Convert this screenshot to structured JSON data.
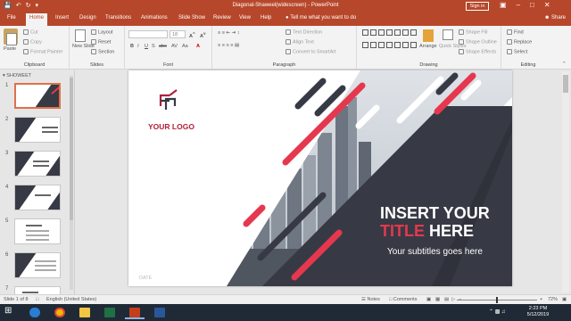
{
  "window": {
    "title": "Diagonal-Shaweel(widescreen) - PowerPoint",
    "sign_in": "Sign in",
    "share": "Share"
  },
  "tabs": [
    "File",
    "Home",
    "Insert",
    "Design",
    "Transitions",
    "Animations",
    "Slide Show",
    "Review",
    "View",
    "Help"
  ],
  "tell_me": "Tell me what you want to do",
  "ribbon": {
    "clipboard": {
      "name": "Clipboard",
      "paste": "Paste",
      "cut": "Cut",
      "copy": "Copy",
      "format_painter": "Format Painter"
    },
    "slides": {
      "name": "Slides",
      "new_slide": "New Slide",
      "layout": "Layout",
      "reset": "Reset",
      "section": "Section"
    },
    "font": {
      "name": "Font",
      "size": "18"
    },
    "paragraph": {
      "name": "Paragraph",
      "text_direction": "Text Direction",
      "align_text": "Align Text",
      "convert": "Convert to SmartArt"
    },
    "drawing": {
      "name": "Drawing",
      "arrange": "Arrange",
      "quick_styles": "Quick Styles",
      "shape_fill": "Shape Fill",
      "shape_outline": "Shape Outline",
      "shape_effects": "Shape Effects"
    },
    "editing": {
      "name": "Editing",
      "find": "Find",
      "replace": "Replace",
      "select": "Select"
    }
  },
  "thumbnails": {
    "section": "SHOWEET",
    "slides": [
      "1",
      "2",
      "3",
      "4",
      "5",
      "6",
      "7"
    ]
  },
  "slide": {
    "logo_text": "YOUR LOGO",
    "title_line1": "INSERT YOUR",
    "title_line2_accent": "TITLE",
    "title_line2_rest": "HERE",
    "subtitle": "Your subtitles goes here",
    "date": "DATE",
    "colors": {
      "dark": "#373a44",
      "accent": "#e5384e",
      "logo_accent": "#b0223a"
    }
  },
  "status": {
    "slide_info": "Slide 1 of 8",
    "language": "English (United States)",
    "notes": "Notes",
    "comments": "Comments",
    "zoom": "72%"
  },
  "taskbar": {
    "time": "2:23 PM",
    "date": "5/12/2019"
  }
}
